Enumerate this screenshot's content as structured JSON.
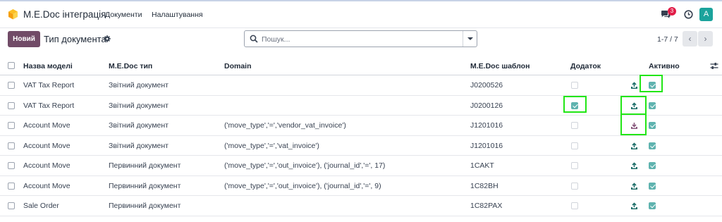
{
  "app": {
    "title": "M.E.Doc інтеграція",
    "menu": [
      "Документи",
      "Налаштування"
    ],
    "notifications_count": "3",
    "avatar_letter": "A",
    "accent_color": "#714b67",
    "avatar_color": "#1ba39c"
  },
  "control": {
    "new_label": "Новий",
    "breadcrumb": "Тип документа",
    "search_placeholder": "Пошук...",
    "pager": "1-7 / 7"
  },
  "table": {
    "columns": [
      "Назва моделі",
      "M.E.Doc тип",
      "Domain",
      "M.E.Doc шаблон",
      "Додаток",
      "Активно"
    ],
    "rows": [
      {
        "model": "VAT Tax Report",
        "type": "Звітний документ",
        "domain": "",
        "template": "J0200526",
        "addon": false,
        "icon": "upload-icon",
        "active": true
      },
      {
        "model": "VAT Tax Report",
        "type": "Звітний документ",
        "domain": "",
        "template": "J0200126",
        "addon": true,
        "icon": "upload-icon",
        "active": true
      },
      {
        "model": "Account Move",
        "type": "Звітний документ",
        "domain": "('move_type','=','vendor_vat_invoice')",
        "template": "J1201016",
        "addon": false,
        "icon": "download-icon",
        "active": true
      },
      {
        "model": "Account Move",
        "type": "Звітний документ",
        "domain": "('move_type','=','vat_invoice')",
        "template": "J1201016",
        "addon": false,
        "icon": "upload-icon",
        "active": true
      },
      {
        "model": "Account Move",
        "type": "Первинний документ",
        "domain": "('move_type','=','out_invoice'), ('journal_id','=', 17)",
        "template": "1CAKT",
        "addon": false,
        "icon": "upload-icon",
        "active": true
      },
      {
        "model": "Account Move",
        "type": "Первинний документ",
        "domain": "('move_type','=','out_invoice'), ('journal_id','=', 9)",
        "template": "1C82BH",
        "addon": false,
        "icon": "upload-icon",
        "active": true
      },
      {
        "model": "Sale Order",
        "type": "Первинний документ",
        "domain": "",
        "template": "1C82PAX",
        "addon": false,
        "icon": "upload-icon",
        "active": true
      }
    ]
  }
}
